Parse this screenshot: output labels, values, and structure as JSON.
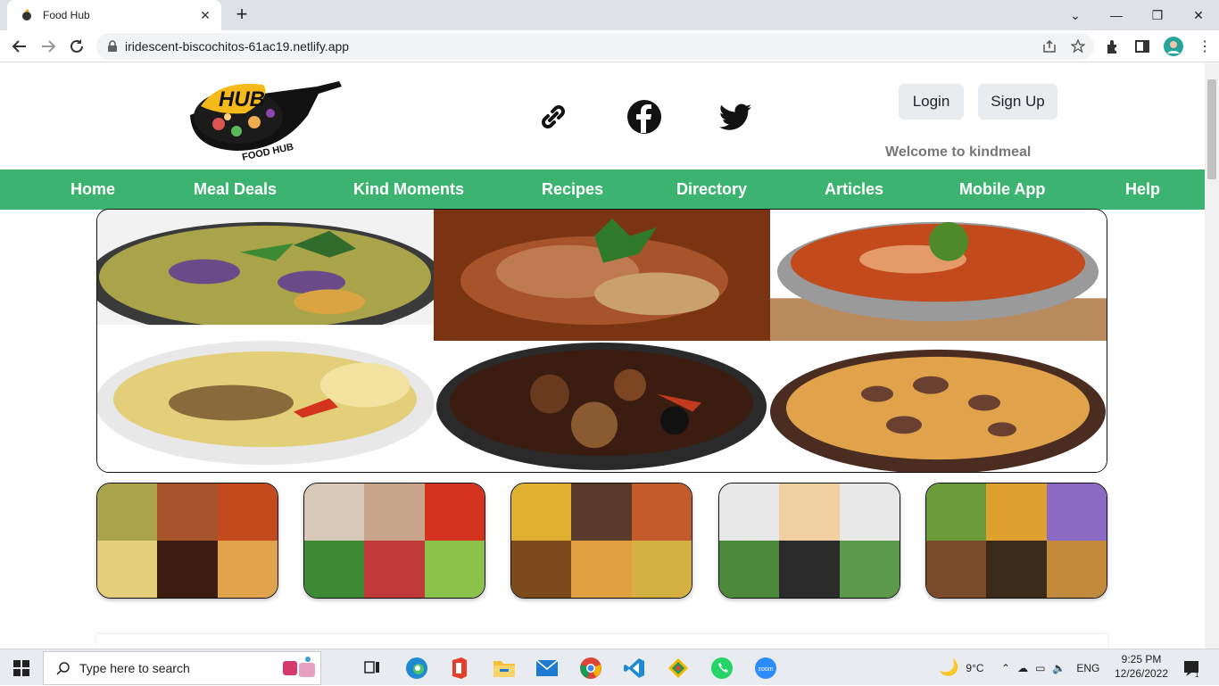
{
  "browser": {
    "tab_title": "Food Hub",
    "url": "iridescent-biscochitos-61ac19.netlify.app"
  },
  "site": {
    "logo_text_top": "HUB",
    "logo_text_bottom": "FOOD HUB",
    "login_label": "Login",
    "signup_label": "Sign Up",
    "welcome": "Welcome to kindmeal",
    "nav": [
      "Home",
      "Meal Deals",
      "Kind Moments",
      "Recipes",
      "Directory",
      "Articles",
      "Mobile App",
      "Help"
    ],
    "social_icons": [
      "link-icon",
      "facebook-icon",
      "twitter-icon"
    ],
    "accent_color": "#3cb371"
  },
  "taskbar": {
    "search_placeholder": "Type here to search",
    "weather": "9°C",
    "language": "ENG",
    "time": "9:25 PM",
    "date": "12/26/2022"
  }
}
